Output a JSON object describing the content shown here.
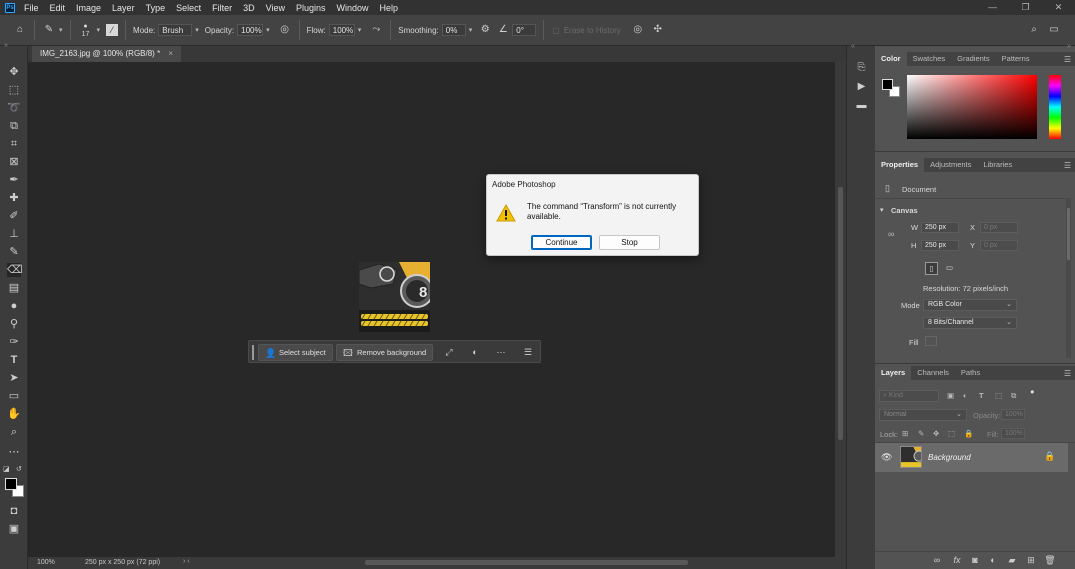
{
  "app": {
    "logo": "Ps"
  },
  "menu": [
    "File",
    "Edit",
    "Image",
    "Layer",
    "Type",
    "Select",
    "Filter",
    "3D",
    "View",
    "Plugins",
    "Window",
    "Help"
  ],
  "window_controls": {
    "minimize": "—",
    "restore": "❐",
    "close": "✕"
  },
  "options_bar": {
    "brush_size": "17",
    "mode_label": "Mode:",
    "mode_value": "Brush",
    "opacity_label": "Opacity:",
    "opacity_value": "100%",
    "flow_label": "Flow:",
    "flow_value": "100%",
    "smoothing_label": "Smoothing:",
    "smoothing_value": "0%",
    "angle_value": "0°",
    "erase_to_history": "Erase to History"
  },
  "document": {
    "tab_title": "IMG_2163.jpg @ 100% (RGB/8) *",
    "zoom": "100%",
    "info": "250 px x 250 px (72 ppi)"
  },
  "context_bar": {
    "select_subject": "Select subject",
    "remove_background": "Remove background"
  },
  "dialog": {
    "title": "Adobe Photoshop",
    "message": "The command “Transform” is not currently available.",
    "continue_label": "Continue",
    "stop_label": "Stop"
  },
  "color_panel": {
    "tabs": [
      "Color",
      "Swatches",
      "Gradients",
      "Patterns"
    ],
    "foreground": "#000000",
    "background": "#ffffff"
  },
  "properties_panel": {
    "tabs": [
      "Properties",
      "Adjustments",
      "Libraries"
    ],
    "section_doc": "Document",
    "canvas_heading": "Canvas",
    "w_label": "W",
    "w_value": "250 px",
    "h_label": "H",
    "h_value": "250 px",
    "x_label": "X",
    "x_value": "0 px",
    "y_label": "Y",
    "y_value": "0 px",
    "resolution": "Resolution: 72 pixels/inch",
    "mode_label": "Mode",
    "mode_value": "RGB Color",
    "bits_value": "8 Bits/Channel",
    "fill_label": "Fill"
  },
  "layers_panel": {
    "tabs": [
      "Layers",
      "Channels",
      "Paths"
    ],
    "kind_placeholder": "Kind",
    "blend_mode": "Normal",
    "opacity_label": "Opacity:",
    "opacity_value": "100%",
    "lock_label": "Lock:",
    "fill_label": "Fill:",
    "fill_value": "100%",
    "layer_name": "Background"
  }
}
